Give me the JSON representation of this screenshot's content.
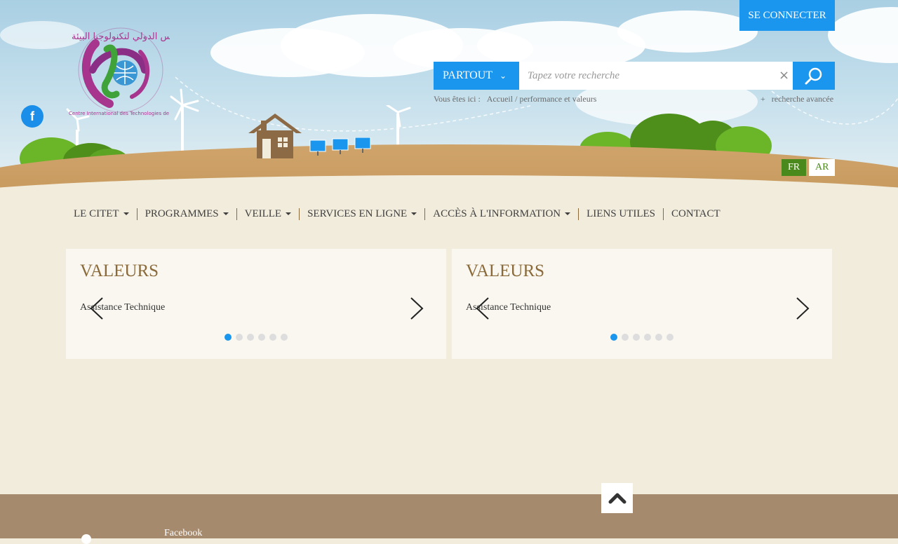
{
  "header": {
    "login_label": "SE CONNECTER",
    "search": {
      "scope_label": "PARTOUT",
      "placeholder": "Tapez votre recherche",
      "clear_symbol": "×",
      "advanced_label": "+   recherche avancée"
    },
    "breadcrumb": {
      "prefix": "Vous êtes ici :",
      "home": "Accueil",
      "separator": "/",
      "current": "performance et valeurs"
    },
    "languages": [
      "FR",
      "AR"
    ],
    "social": {
      "facebook_glyph": "f"
    },
    "logo": {
      "arabic_text": "مركز تونس الدولي لتكنولوجيا البيئة",
      "latin_text": "Centre International des Technologies de l'Environnement de Tunis"
    }
  },
  "nav": {
    "items": [
      {
        "label": "LE CITET",
        "dropdown": true
      },
      {
        "label": "PROGRAMMES",
        "dropdown": true
      },
      {
        "label": "VEILLE",
        "dropdown": true
      },
      {
        "label": "SERVICES EN LIGNE",
        "dropdown": true
      },
      {
        "label": "ACCÈS À L'INFORMATION",
        "dropdown": true
      },
      {
        "label": "LIENS UTILES",
        "dropdown": false
      },
      {
        "label": "CONTACT",
        "dropdown": false
      }
    ]
  },
  "panels": [
    {
      "title": "VALEURS",
      "slide_text": "Assistance Technique",
      "slide_count": 6,
      "active_slide": 1
    },
    {
      "title": "VALEURS",
      "slide_text": "Assistance Technique",
      "slide_count": 6,
      "active_slide": 1
    }
  ],
  "footer": {
    "facebook_label": "Facebook"
  },
  "colors": {
    "accent_blue": "#1a96ee",
    "accent_green": "#4a8a1c",
    "brown": "#8a6a3a",
    "footer": "#a58a6e",
    "background": "#f2ecdc"
  }
}
